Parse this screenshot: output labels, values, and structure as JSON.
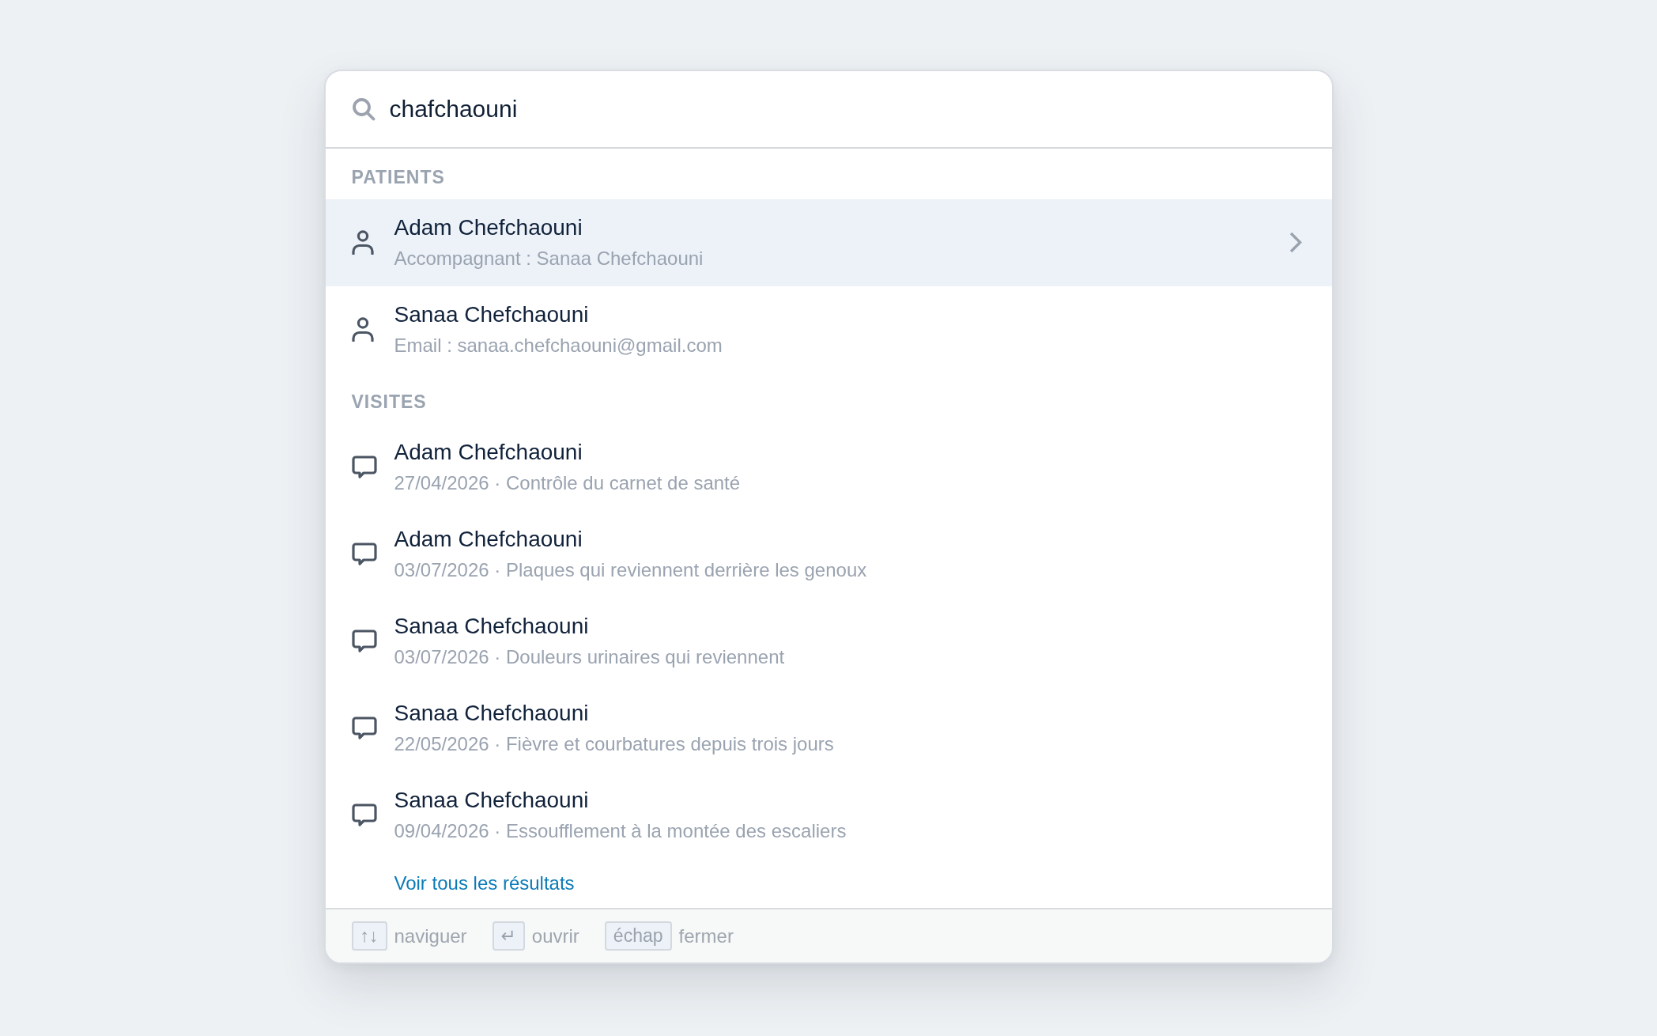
{
  "search": {
    "value": "chafchaouni"
  },
  "sections": [
    {
      "heading": "PATIENTS",
      "kind": "patient",
      "results": [
        {
          "title": "Adam Chefchaouni",
          "detail": "Accompagnant : Sanaa Chefchaouni",
          "selected": true
        },
        {
          "title": "Sanaa Chefchaouni",
          "detail": "Email : sanaa.chefchaouni@gmail.com",
          "selected": false
        }
      ]
    },
    {
      "heading": "VISITES",
      "kind": "visit",
      "results": [
        {
          "title": "Adam Chefchaouni",
          "detail": "27/04/2026 · Contrôle du carnet de santé",
          "selected": false
        },
        {
          "title": "Adam Chefchaouni",
          "detail": "03/07/2026 · Plaques qui reviennent derrière les genoux",
          "selected": false
        },
        {
          "title": "Sanaa Chefchaouni",
          "detail": "03/07/2026 · Douleurs urinaires qui reviennent",
          "selected": false
        },
        {
          "title": "Sanaa Chefchaouni",
          "detail": "22/05/2026 · Fièvre et courbatures depuis trois jours",
          "selected": false
        },
        {
          "title": "Sanaa Chefchaouni",
          "detail": "09/04/2026 · Essoufflement à la montée des escaliers",
          "selected": false
        }
      ]
    }
  ],
  "see_all_link": "Voir tous les résultats",
  "footer_hints": [
    {
      "key": "↑↓",
      "label": "naviguer"
    },
    {
      "key": "↵",
      "label": "ouvrir"
    },
    {
      "key": "échap",
      "label": "fermer"
    }
  ]
}
